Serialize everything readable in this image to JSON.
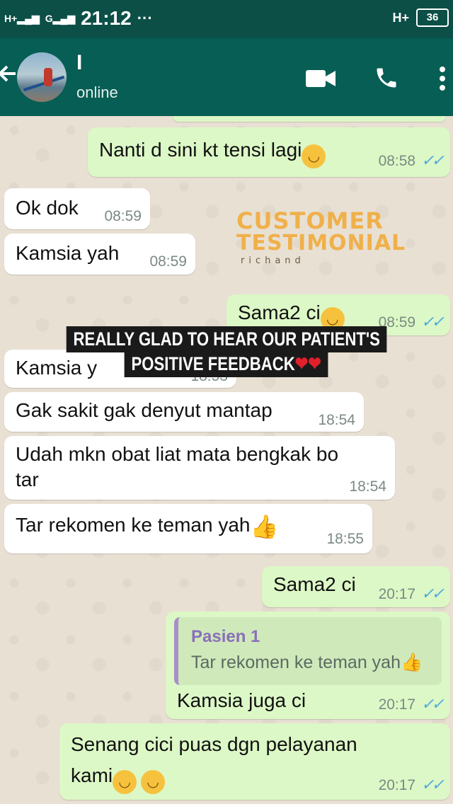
{
  "status_bar": {
    "network_1": "H+",
    "network_2": "G",
    "time": "21:12",
    "more": "···",
    "network_right": "H+",
    "battery": "36"
  },
  "header": {
    "back_icon": "arrow-left-icon",
    "contact_name": "I",
    "contact_status": "online",
    "video_icon": "video-camera-icon",
    "call_icon": "phone-icon",
    "menu_icon": "more-vertical-icon"
  },
  "messages": [
    {
      "dir": "out",
      "text": "Nanti d sini kt tensi lagi",
      "emoji": "😊",
      "time": "08:58",
      "ticks": "✓✓"
    },
    {
      "dir": "in",
      "text": "Ok dok",
      "time": "08:59"
    },
    {
      "dir": "in",
      "text": "Kamsia yah",
      "time": "08:59"
    },
    {
      "dir": "out",
      "text": "Sama2 ci",
      "emoji": "😊",
      "time": "08:59",
      "ticks": "✓✓"
    },
    {
      "dir": "in",
      "text": "Kamsia y",
      "time": "18:53"
    },
    {
      "dir": "in",
      "text": "Gak sakit gak denyut mantap",
      "time": "18:54"
    },
    {
      "dir": "in",
      "text_line1": "Udah mkn obat liat mata bengkak bo",
      "text_line2": "tar",
      "time": "18:54"
    },
    {
      "dir": "in",
      "text": "Tar rekomen ke teman yah",
      "emoji": "👍",
      "time": "18:55"
    },
    {
      "dir": "out",
      "text": "Sama2 ci",
      "time": "20:17",
      "ticks": "✓✓"
    },
    {
      "dir": "out",
      "quote_name": "Pasien 1",
      "quote_text": "Tar rekomen ke teman yah👍",
      "text": "Kamsia juga ci",
      "time": "20:17",
      "ticks": "✓✓"
    },
    {
      "dir": "out",
      "text_line1": "Senang cici puas dgn pelayanan",
      "text_line2": "kami",
      "emoji": "😊😊",
      "time": "20:17",
      "ticks": "✓✓"
    }
  ],
  "watermark": {
    "line1": "CUSTOMER",
    "line2": "TESTIMONIAL",
    "line3": "richand"
  },
  "caption": {
    "line1": "REALLY GLAD TO HEAR OUR PATIENT'S",
    "line2": "POSITIVE FEEDBACK",
    "hearts": "❤❤"
  },
  "colors": {
    "header": "#075e54",
    "status_bar": "#0b4f46",
    "incoming": "#ffffff",
    "outgoing": "#dcf8c6",
    "watermark": "#f0b04a",
    "read_ticks": "#4fa8e0"
  }
}
